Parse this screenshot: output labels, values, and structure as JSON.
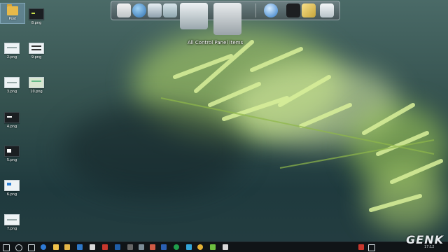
{
  "desktop": {
    "icons": [
      {
        "label": "Post"
      },
      {
        "label": "8.png"
      },
      {
        "label": "2.png"
      },
      {
        "label": "9.png"
      },
      {
        "label": "3.png"
      },
      {
        "label": "10.png"
      },
      {
        "label": "4.png"
      },
      {
        "label": "5.png"
      },
      {
        "label": "6.png"
      },
      {
        "label": "7.png"
      }
    ]
  },
  "dock": {
    "tooltip": "All Control Panel Items",
    "items": [
      "notes-icon",
      "globe-icon",
      "mail-icon",
      "folder-icon",
      "control-panel-icon",
      "tools-icon",
      "network-globe-icon",
      "tshirt-icon",
      "pen-icon",
      "recycle-bin-icon"
    ]
  },
  "taskbar": {
    "tray_time": "17:12",
    "brand": "GENK"
  },
  "colors": {
    "foliage": "#b9e06a",
    "foliage_light": "#e4f5a8",
    "background": "#35524f",
    "taskbar": "#101417"
  }
}
